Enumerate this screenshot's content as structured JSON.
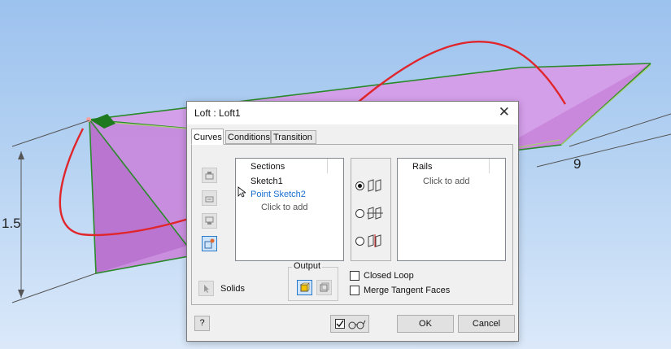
{
  "viewport": {
    "dimension_height": "1.5",
    "dimension_length": "9",
    "colors": {
      "face": "#d89ae8",
      "edge_green": "#2a8a2a",
      "curve_red": "#e0252b",
      "dim_line": "#555555"
    }
  },
  "dialog": {
    "title": "Loft : Loft1",
    "close_symbol": "✕",
    "tabs": [
      {
        "label": "Curves",
        "active": true
      },
      {
        "label": "Conditions",
        "active": false
      },
      {
        "label": "Transition",
        "active": false
      }
    ],
    "sections": {
      "header": "Sections",
      "items": [
        "Sketch1",
        "Point Sketch2"
      ],
      "selected_index": 1,
      "hint": "Click to add"
    },
    "rails": {
      "header": "Rails",
      "hint": "Click to add"
    },
    "output": {
      "label": "Output"
    },
    "solids_label": "Solids",
    "options": {
      "closed_loop": {
        "label": "Closed Loop",
        "checked": false
      },
      "merge_tangent_faces": {
        "label": "Merge Tangent Faces",
        "checked": false
      }
    },
    "footer": {
      "help_symbol": "?",
      "preview_checked": true,
      "ok_label": "OK",
      "cancel_label": "Cancel"
    }
  }
}
